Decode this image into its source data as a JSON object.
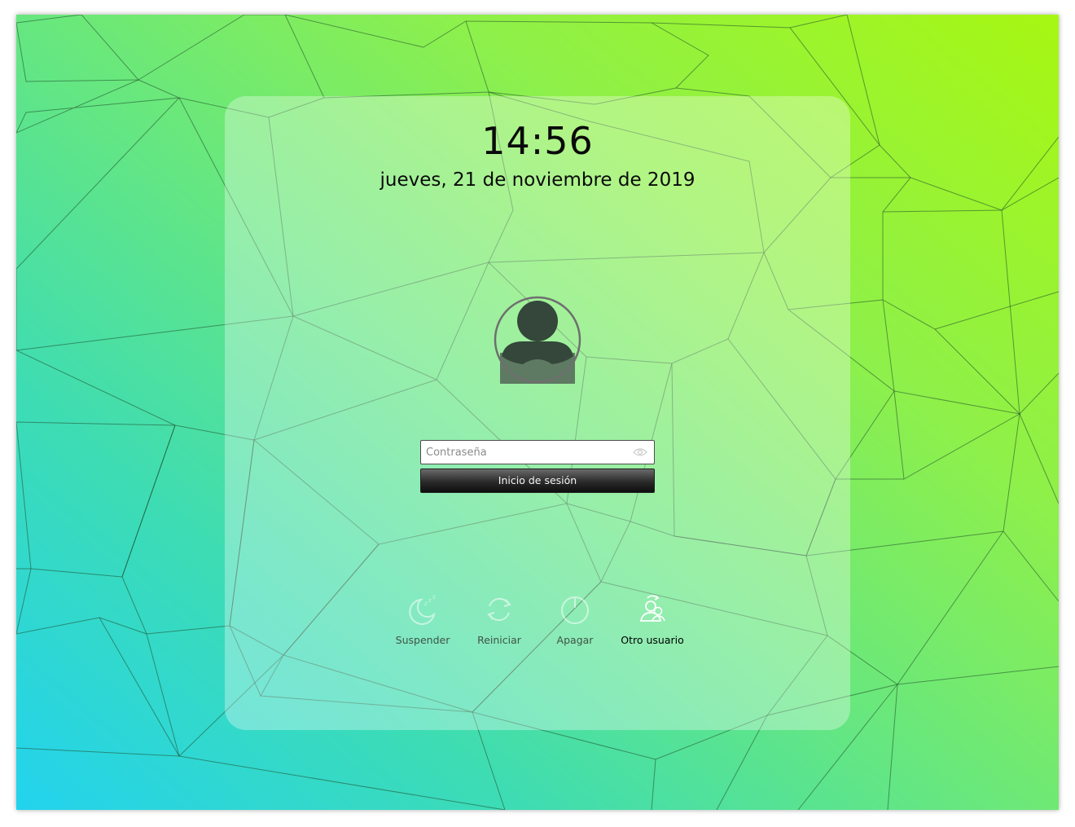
{
  "clock": {
    "time": "14:56"
  },
  "date": {
    "text": "jueves, 21 de noviembre de 2019"
  },
  "user": {
    "name": "",
    "avatar_icon": "user-silhouette-icon"
  },
  "login": {
    "password_placeholder": "Contraseña",
    "password_value": "",
    "show_password_icon": "eye-icon",
    "submit_label": "Inicio de sesión"
  },
  "actions": [
    {
      "label": "Suspender",
      "icon": "sleep-moon-icon"
    },
    {
      "label": "Reiniciar",
      "icon": "restart-icon"
    },
    {
      "label": "Apagar",
      "icon": "power-icon"
    },
    {
      "label": "Otro usuario",
      "icon": "switch-user-icon"
    }
  ],
  "colors": {
    "background_start": "#22d3ee",
    "background_end": "#a7f712",
    "button_dark": "#1a1a1a"
  }
}
